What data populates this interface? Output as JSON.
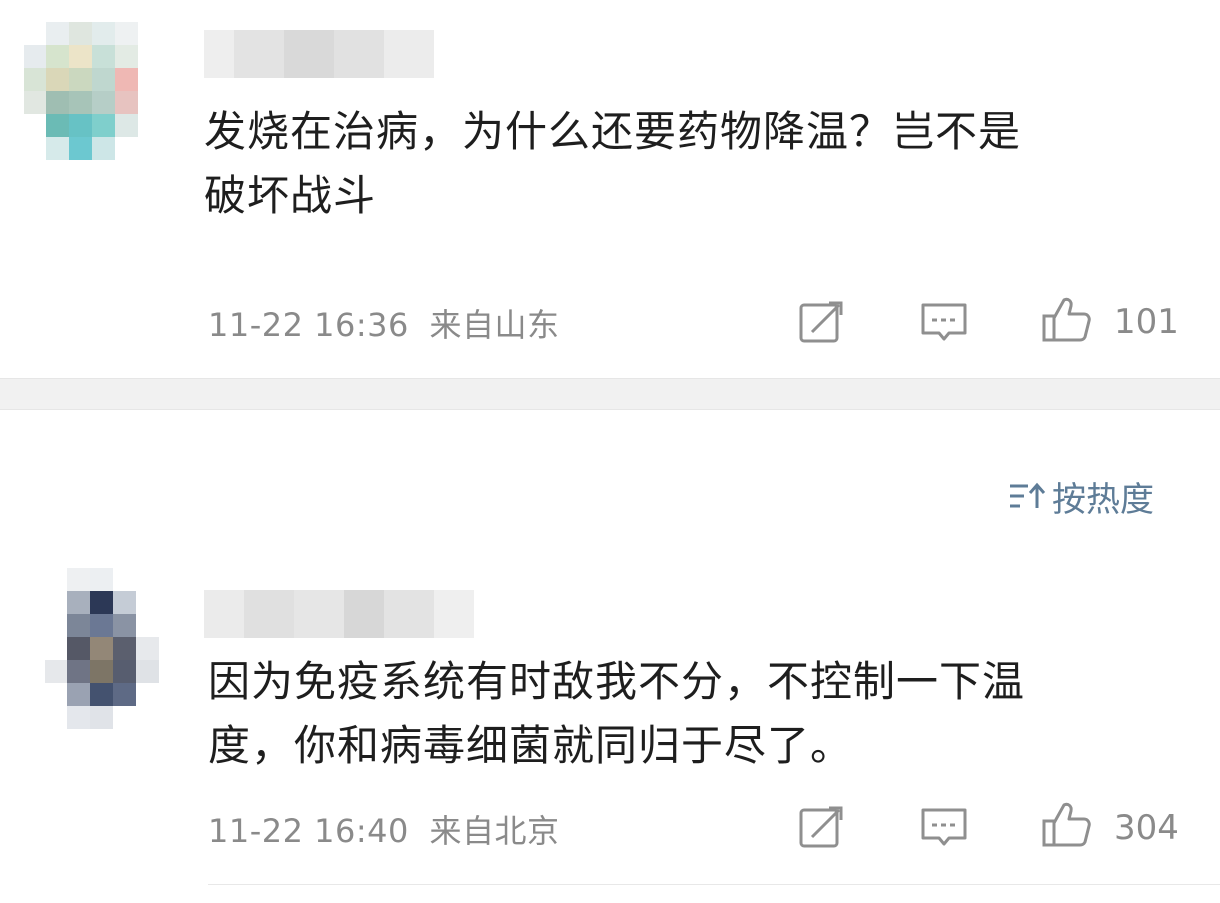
{
  "post": {
    "comment_text_line1": "发烧在治病，为什么还要药物降温？岂不是",
    "comment_text_line2": "破坏战斗",
    "timestamp": "11-22 16:36",
    "location": "来自山东",
    "like_count": "101"
  },
  "sort": {
    "label": "按热度",
    "icon": "sort-icon"
  },
  "reply": {
    "comment_text_line1": "因为免疫系统有时敌我不分，不控制一下温",
    "comment_text_line2": "度，你和病毒细菌就同归于尽了。",
    "timestamp": "11-22 16:40",
    "location": "来自北京",
    "like_count": "304"
  },
  "icons": {
    "share": "share-icon",
    "comment": "comment-icon",
    "like": "thumbs-up-icon"
  },
  "colors": {
    "text": "#1e1e1e",
    "meta": "#8a8a8a",
    "link": "#5e7c97",
    "divider": "#f1f1f1"
  }
}
